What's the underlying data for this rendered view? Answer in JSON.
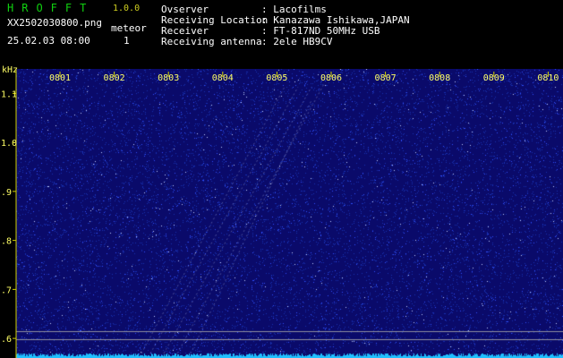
{
  "header": {
    "app_name": "HROFFT",
    "version": "1.0.0",
    "filename": "XX2502030800.png",
    "datetime": "25.02.03 08:00",
    "meteor_label": "meteor",
    "meteor_count": "1",
    "info": [
      {
        "key": "Ovserver",
        "value": ": Lacofilms"
      },
      {
        "key": "Receiving Location",
        "value": ": Kanazawa Ishikawa,JAPAN"
      },
      {
        "key": "Receiver",
        "value": ": FT-817ND 50MHz USB"
      },
      {
        "key": "Receiving antenna",
        "value": ": 2ele HB9CV"
      }
    ]
  },
  "chart_data": {
    "type": "heatmap",
    "ylabel": "kHz",
    "x_ticks": [
      "0801",
      "0802",
      "0803",
      "0804",
      "0805",
      "0806",
      "0807",
      "0808",
      "0809",
      "0810"
    ],
    "y_ticks": [
      "1.1",
      "1.0",
      ".9",
      ".8",
      ".7",
      ".6"
    ],
    "ylim": [
      0.56,
      1.15
    ],
    "colors": {
      "background": "#0a0a6a",
      "noise": "#3050ff",
      "meteor": "#c8d8ff",
      "baseline": "#20c0ff",
      "tick_label": "#ffff66"
    }
  }
}
